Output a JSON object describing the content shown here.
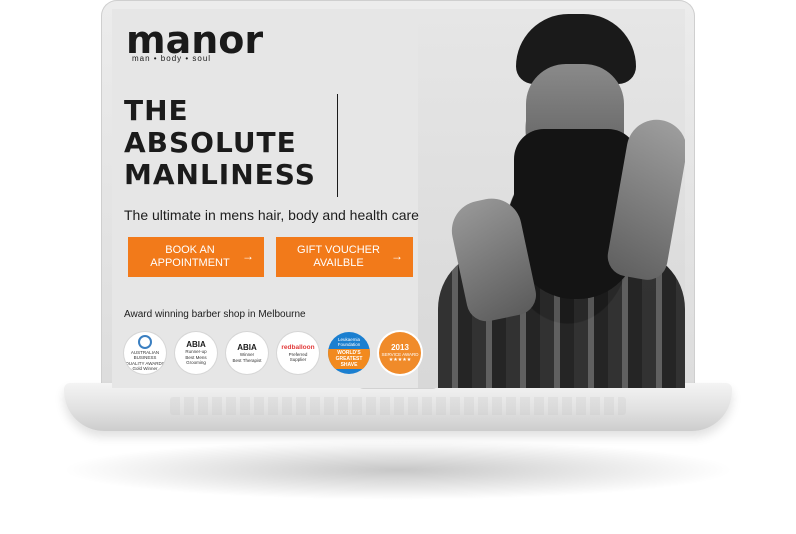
{
  "site": {
    "logo": "manor",
    "tagline": "man  •  body  •  soul"
  },
  "hero": {
    "headline_line1": "THE",
    "headline_line2": "ABSOLUTE",
    "headline_line3": "MANLINESS",
    "subheadline": "The ultimate in mens hair, body and health care",
    "photo_description_icon": "bearded-man-photo"
  },
  "buttons": {
    "book": {
      "label": "BOOK AN APPOINTMENT",
      "arrow": "→"
    },
    "gift": {
      "label": "GIFT VOUCHER AVAILBLE",
      "arrow": "→"
    }
  },
  "awards": {
    "heading": "Award winning barber shop in Melbourne",
    "badges": [
      {
        "l1": "AUSTRALIAN",
        "l2": "BUSINESS",
        "l3": "QUALITY AWARDS",
        "l4": "Gold Winner"
      },
      {
        "brand": "ABIA",
        "l1": "Runner-up",
        "l2": "Best Mens",
        "l3": "Grooming"
      },
      {
        "brand": "ABIA",
        "l1": "Winner",
        "l2": "Best Therapist"
      },
      {
        "brand": "redballoon",
        "l1": "Preferred",
        "l2": "Supplier"
      },
      {
        "l1": "Leukaemia",
        "l2": "Foundation",
        "strip": "WORLD'S GREATEST SHAVE"
      },
      {
        "year": "2013",
        "l1": "SERVICE AWARD",
        "stars": "★★★★★"
      }
    ]
  },
  "colors": {
    "accent": "#f27a1a",
    "text": "#1b1b1b",
    "screen_bg": "#e6e6e6"
  }
}
